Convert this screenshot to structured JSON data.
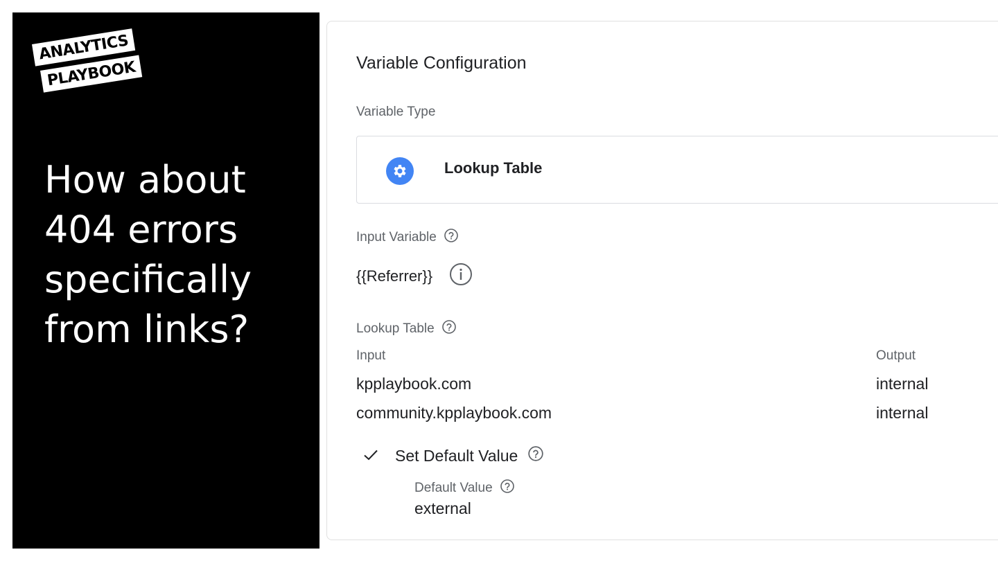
{
  "brand": {
    "logo_line1": "ANALYTICS",
    "logo_line2": "PLAYBOOK"
  },
  "headline": {
    "line1": "How about",
    "line2": "404 errors",
    "line3": "specifically",
    "line4": "from links?"
  },
  "config": {
    "title": "Variable Configuration",
    "variable_type_label": "Variable Type",
    "variable_type_value": "Lookup Table",
    "variable_type_icon": "gear-icon",
    "input_variable_label": "Input Variable",
    "input_variable_value": "{{Referrer}}",
    "lookup_table_label": "Lookup Table",
    "lookup_columns": {
      "input": "Input",
      "output": "Output"
    },
    "lookup_rows": [
      {
        "input": "kpplaybook.com",
        "output": "internal"
      },
      {
        "input": "community.kpplaybook.com",
        "output": "internal"
      }
    ],
    "set_default_label": "Set Default Value",
    "default_value_label": "Default Value",
    "default_value": "external"
  },
  "colors": {
    "accent_blue": "#4285f4",
    "background_dark": "#000000"
  }
}
